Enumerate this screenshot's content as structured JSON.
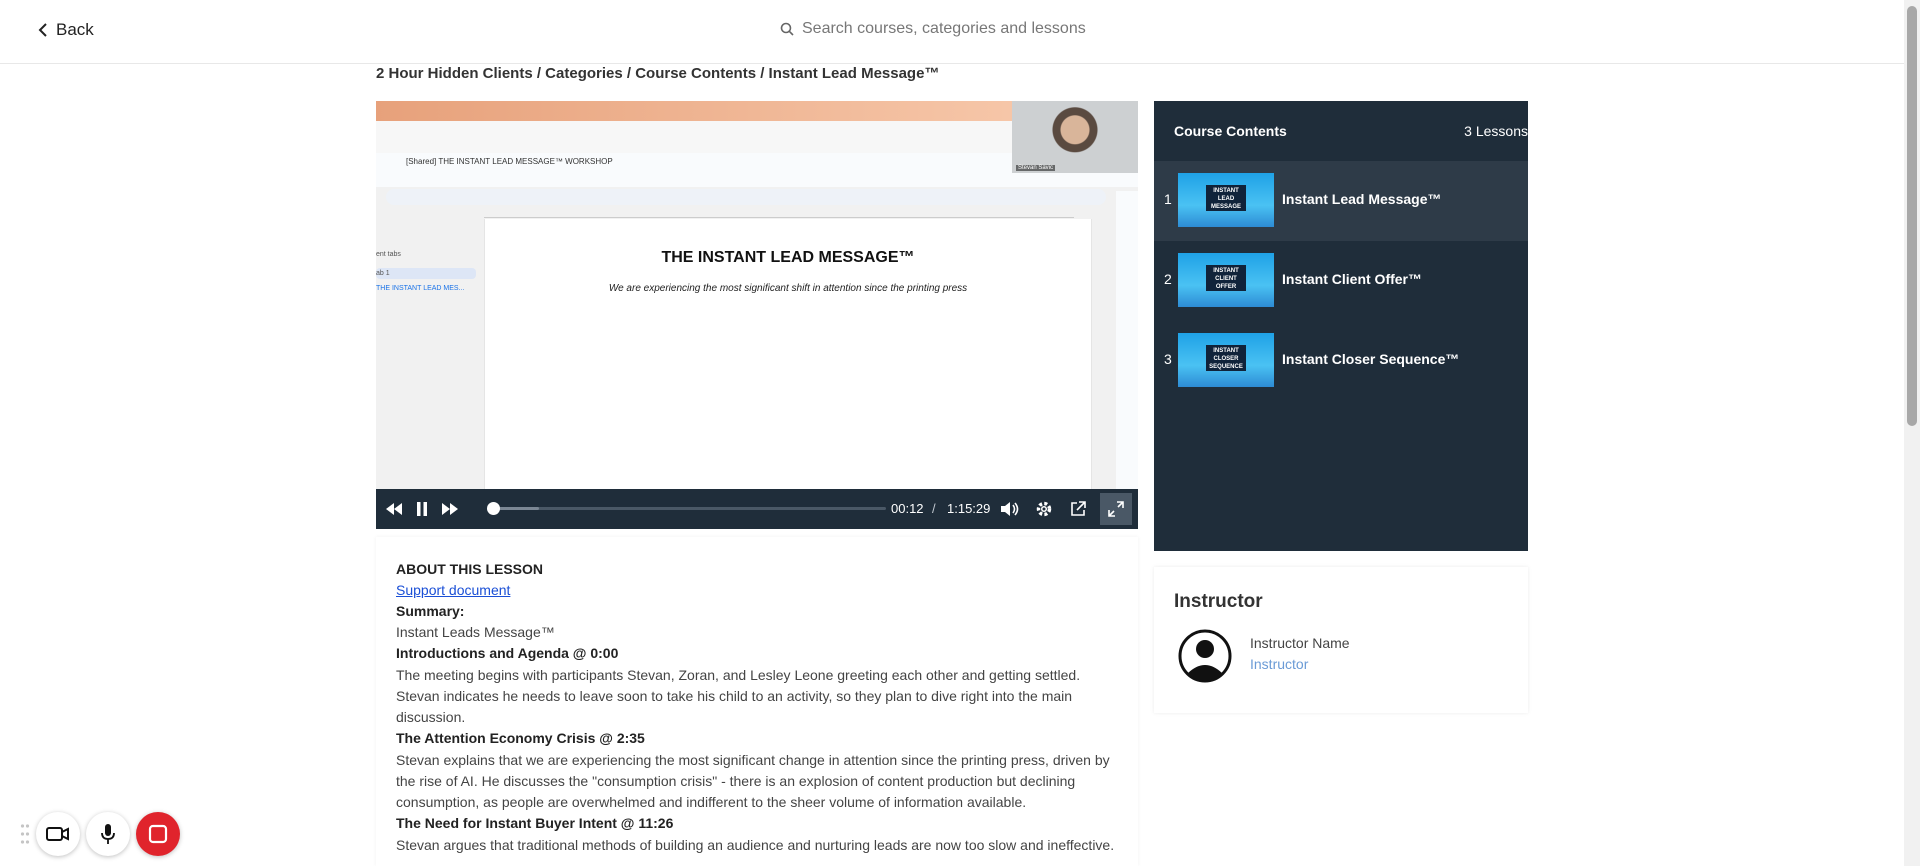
{
  "topbar": {
    "back_label": "Back",
    "search_placeholder": "Search courses, categories and lessons"
  },
  "breadcrumb": "2 Hour Hidden Clients / Categories / Course Contents / Instant Lead Message™",
  "video": {
    "doc_title": "[Shared] THE INSTANT LEAD MESSAGE™ WORKSHOP",
    "doc_heading": "THE INSTANT LEAD MESSAGE™",
    "doc_subheading": "We are experiencing the most significant shift in attention since the printing press",
    "outline_label": "ent tabs",
    "outline_tab": "ab 1",
    "outline_item": "THE INSTANT LEAD MES...",
    "camera_name": "Stevan Savic",
    "current_time": "00:12",
    "time_sep": "/",
    "duration": "1:15:29",
    "progress": 0.003,
    "buffered": 0.12
  },
  "about": {
    "heading": "ABOUT THIS LESSON",
    "support_link": "Support document",
    "summary_label": "Summary:",
    "summary_text": "Instant Leads Message™",
    "sections": [
      {
        "title": "Introductions and Agenda @ 0:00",
        "body": "The meeting begins with participants Stevan, Zoran, and Lesley Leone greeting each other and getting settled. Stevan indicates he needs to leave soon to take his child to an activity, so they plan to dive right into the main discussion."
      },
      {
        "title": "The Attention Economy Crisis @ 2:35",
        "body": "Stevan explains that we are experiencing the most significant change in attention since the printing press, driven by the rise of AI. He discusses the \"consumption crisis\" - there is an explosion of content production but declining consumption, as people are overwhelmed and indifferent to the sheer volume of information available."
      },
      {
        "title": "The Need for Instant Buyer Intent @ 11:26",
        "body": "Stevan argues that traditional methods of building an audience and nurturing leads are now too slow and ineffective."
      }
    ]
  },
  "course": {
    "title": "Course Contents",
    "count": "3 Lessons",
    "lessons": [
      {
        "num": "1",
        "title": "Instant Lead Message™",
        "thumb": [
          "INSTANT",
          "LEAD",
          "MESSAGE"
        ]
      },
      {
        "num": "2",
        "title": "Instant Client Offer™",
        "thumb": [
          "INSTANT",
          "CLIENT",
          "OFFER"
        ]
      },
      {
        "num": "3",
        "title": "Instant Closer Sequence™",
        "thumb": [
          "INSTANT",
          "CLOSER",
          "SEQUENCE"
        ]
      }
    ]
  },
  "instructor": {
    "title": "Instructor",
    "name": "Instructor Name",
    "role": "Instructor"
  },
  "colors": {
    "panel": "#1f2d3a",
    "active_row": "#2e3b48",
    "link": "#1a4fd6",
    "stop": "#e0242c"
  }
}
